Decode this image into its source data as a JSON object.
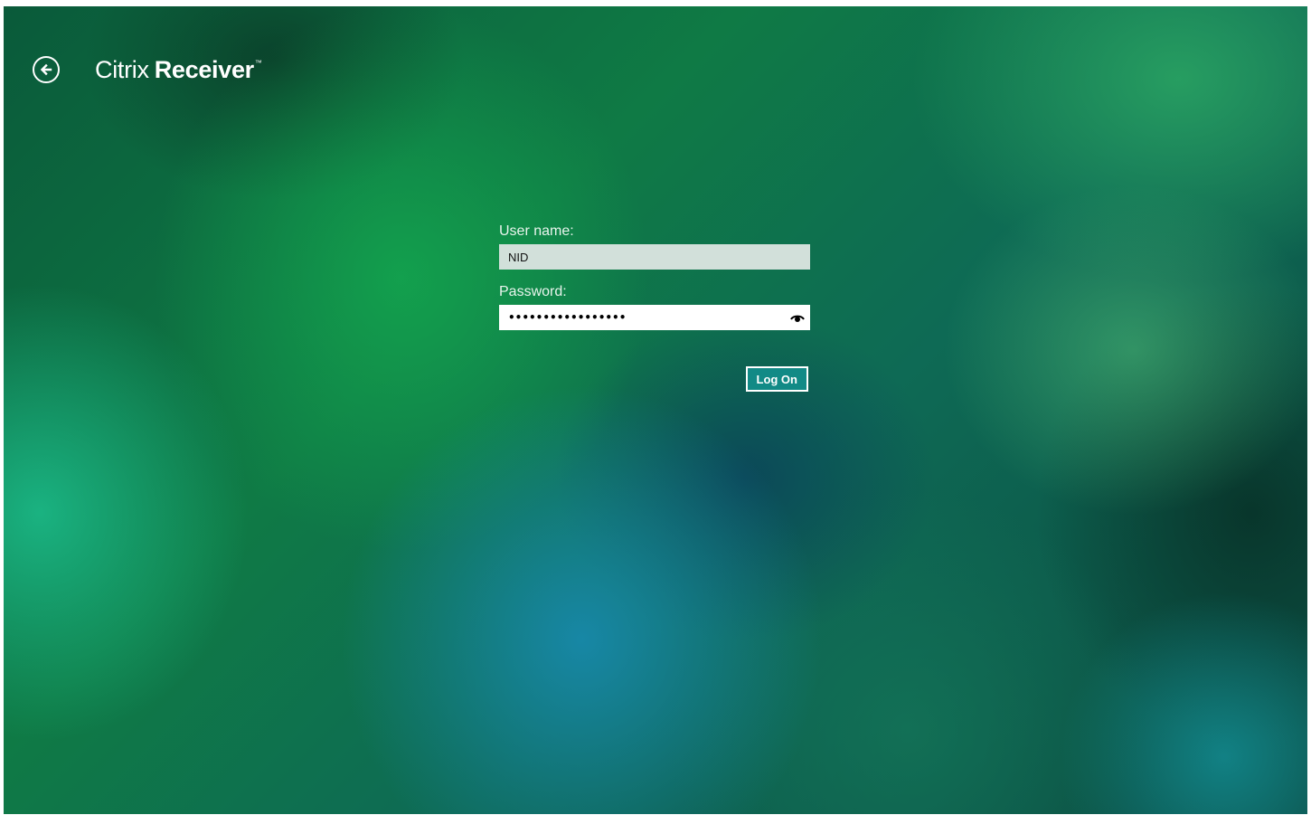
{
  "header": {
    "back_icon": "arrow-left-circle-icon",
    "brand_light": "Citrix",
    "brand_bold": "Receiver",
    "brand_tm": "™"
  },
  "login": {
    "username_label": "User name:",
    "username_value": "NID",
    "password_label": "Password:",
    "password_masked": "•••••••••••••••••",
    "reveal_icon": "eye-icon",
    "logon_label": "Log On"
  },
  "colors": {
    "accent_button": "#128a86",
    "username_field_bg": "#d2e0da",
    "text_light": "#ffffff"
  }
}
